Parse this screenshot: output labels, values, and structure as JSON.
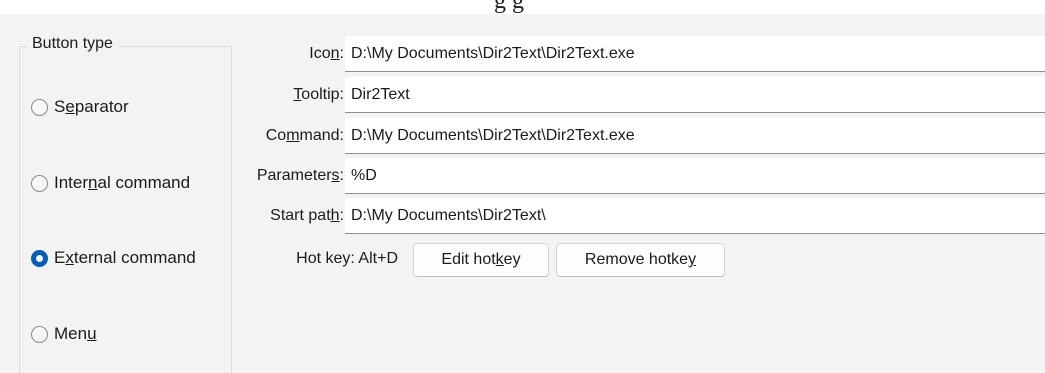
{
  "top_strip": {
    "cropped_text": "g   g"
  },
  "button_type_group": {
    "legend": "Button type",
    "options": [
      {
        "pre": "S",
        "mnemonic": "e",
        "post": "parator",
        "checked": false
      },
      {
        "pre": "Inter",
        "mnemonic": "n",
        "post": "al command",
        "checked": false
      },
      {
        "pre": "E",
        "mnemonic": "x",
        "post": "ternal command",
        "checked": true
      },
      {
        "pre": "Men",
        "mnemonic": "u",
        "post": "",
        "checked": false
      }
    ]
  },
  "fields": {
    "icon": {
      "label_pre": "Ico",
      "label_mn": "n",
      "label_post": ":",
      "value": "D:\\My Documents\\Dir2Text\\Dir2Text.exe"
    },
    "tooltip": {
      "label_pre": "",
      "label_mn": "T",
      "label_post": "ooltip:",
      "value": "Dir2Text"
    },
    "command": {
      "label_pre": "Co",
      "label_mn": "m",
      "label_post": "mand:",
      "value": "D:\\My Documents\\Dir2Text\\Dir2Text.exe"
    },
    "parameters": {
      "label_pre": "Parameter",
      "label_mn": "s",
      "label_post": ":",
      "value": "%D"
    },
    "start_path": {
      "label_pre": "Start pat",
      "label_mn": "h",
      "label_post": ":",
      "value": "D:\\My Documents\\Dir2Text\\"
    }
  },
  "hotkey": {
    "label": "Hot key: Alt+D",
    "edit_pre": "Edit hot",
    "edit_mn": "k",
    "edit_post": "ey",
    "remove_pre": "Remove hotke",
    "remove_mn": "y",
    "remove_post": ""
  }
}
